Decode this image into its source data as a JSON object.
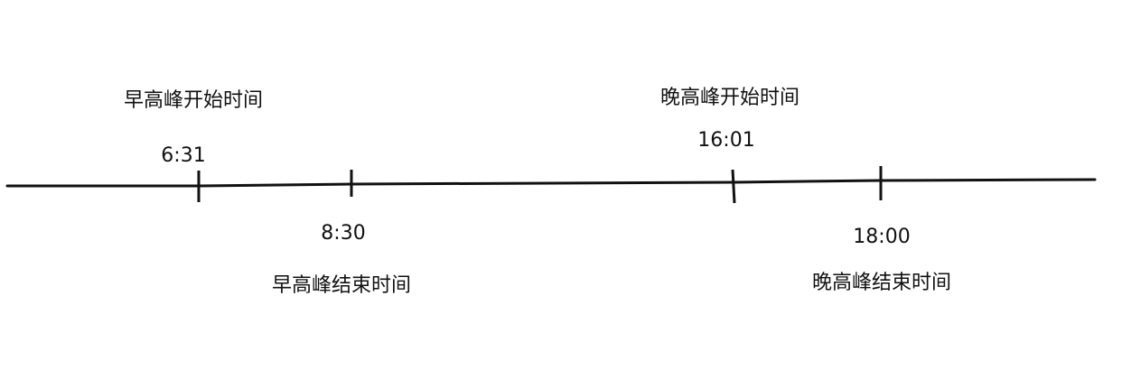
{
  "timeline": {
    "morning_peak": {
      "start": {
        "time": "6:31",
        "caption": "早高峰开始时间"
      },
      "end": {
        "time": "8:30",
        "caption": "早高峰结束时间"
      }
    },
    "evening_peak": {
      "start": {
        "time": "16:01",
        "caption": "晚高峰开始时间"
      },
      "end": {
        "time": "18:00",
        "caption": "晚高峰结束时间"
      }
    },
    "line_color": "#111111"
  }
}
